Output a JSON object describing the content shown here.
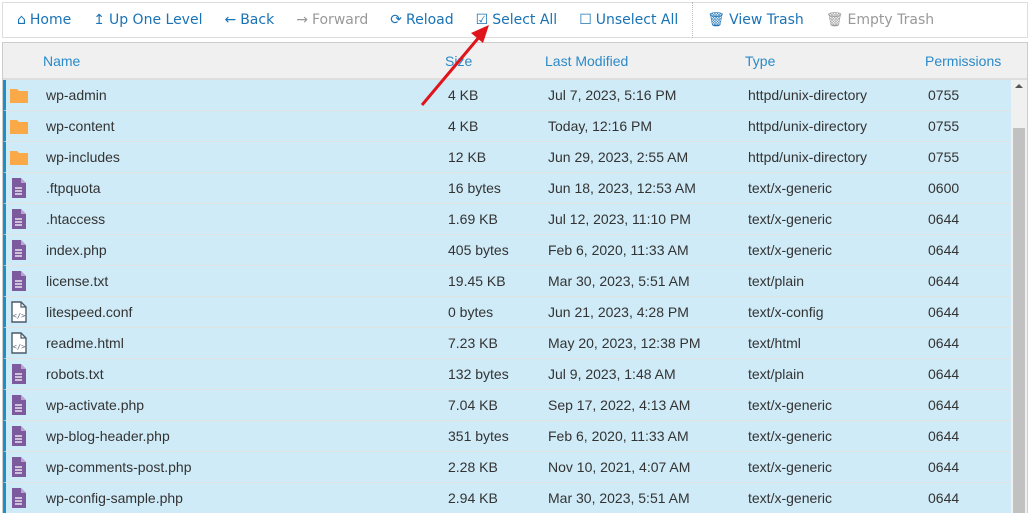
{
  "toolbar": {
    "items": [
      {
        "label": "Home",
        "icon": "home-icon",
        "enabled": true
      },
      {
        "label": "Up One Level",
        "icon": "level-up-icon",
        "enabled": true
      },
      {
        "label": "Back",
        "icon": "arrow-left-icon",
        "enabled": true
      },
      {
        "label": "Forward",
        "icon": "arrow-right-icon",
        "enabled": false
      },
      {
        "label": "Reload",
        "icon": "refresh-icon",
        "enabled": true
      },
      {
        "label": "Select All",
        "icon": "checkbox-checked-icon",
        "enabled": true
      },
      {
        "label": "Unselect All",
        "icon": "checkbox-empty-icon",
        "enabled": true
      },
      {
        "label": "View Trash",
        "icon": "trash-icon",
        "enabled": true
      },
      {
        "label": "Empty Trash",
        "icon": "trash-icon",
        "enabled": false
      }
    ]
  },
  "columns": [
    "Name",
    "Size",
    "Last Modified",
    "Type",
    "Permissions"
  ],
  "files": [
    {
      "name": "wp-admin",
      "size": "4 KB",
      "modified": "Jul 7, 2023, 5:16 PM",
      "type": "httpd/unix-directory",
      "perms": "0755",
      "icon": "folder"
    },
    {
      "name": "wp-content",
      "size": "4 KB",
      "modified": "Today, 12:16 PM",
      "type": "httpd/unix-directory",
      "perms": "0755",
      "icon": "folder"
    },
    {
      "name": "wp-includes",
      "size": "12 KB",
      "modified": "Jun 29, 2023, 2:55 AM",
      "type": "httpd/unix-directory",
      "perms": "0755",
      "icon": "folder"
    },
    {
      "name": ".ftpquota",
      "size": "16 bytes",
      "modified": "Jun 18, 2023, 12:53 AM",
      "type": "text/x-generic",
      "perms": "0600",
      "icon": "text"
    },
    {
      "name": ".htaccess",
      "size": "1.69 KB",
      "modified": "Jul 12, 2023, 11:10 PM",
      "type": "text/x-generic",
      "perms": "0644",
      "icon": "text"
    },
    {
      "name": "index.php",
      "size": "405 bytes",
      "modified": "Feb 6, 2020, 11:33 AM",
      "type": "text/x-generic",
      "perms": "0644",
      "icon": "text"
    },
    {
      "name": "license.txt",
      "size": "19.45 KB",
      "modified": "Mar 30, 2023, 5:51 AM",
      "type": "text/plain",
      "perms": "0644",
      "icon": "text"
    },
    {
      "name": "litespeed.conf",
      "size": "0 bytes",
      "modified": "Jun 21, 2023, 4:28 PM",
      "type": "text/x-config",
      "perms": "0644",
      "icon": "code"
    },
    {
      "name": "readme.html",
      "size": "7.23 KB",
      "modified": "May 20, 2023, 12:38 PM",
      "type": "text/html",
      "perms": "0644",
      "icon": "code"
    },
    {
      "name": "robots.txt",
      "size": "132 bytes",
      "modified": "Jul 9, 2023, 1:48 AM",
      "type": "text/plain",
      "perms": "0644",
      "icon": "text"
    },
    {
      "name": "wp-activate.php",
      "size": "7.04 KB",
      "modified": "Sep 17, 2022, 4:13 AM",
      "type": "text/x-generic",
      "perms": "0644",
      "icon": "text"
    },
    {
      "name": "wp-blog-header.php",
      "size": "351 bytes",
      "modified": "Feb 6, 2020, 11:33 AM",
      "type": "text/x-generic",
      "perms": "0644",
      "icon": "text"
    },
    {
      "name": "wp-comments-post.php",
      "size": "2.28 KB",
      "modified": "Nov 10, 2021, 4:07 AM",
      "type": "text/x-generic",
      "perms": "0644",
      "icon": "text"
    },
    {
      "name": "wp-config-sample.php",
      "size": "2.94 KB",
      "modified": "Mar 30, 2023, 5:51 AM",
      "type": "text/x-generic",
      "perms": "0644",
      "icon": "text"
    }
  ],
  "colors": {
    "accent": "#1a73b5",
    "selected_row": "#cfebf7",
    "folder": "#f9a947",
    "file": "#7d5a9e",
    "annotation_arrow": "#e0141b"
  }
}
